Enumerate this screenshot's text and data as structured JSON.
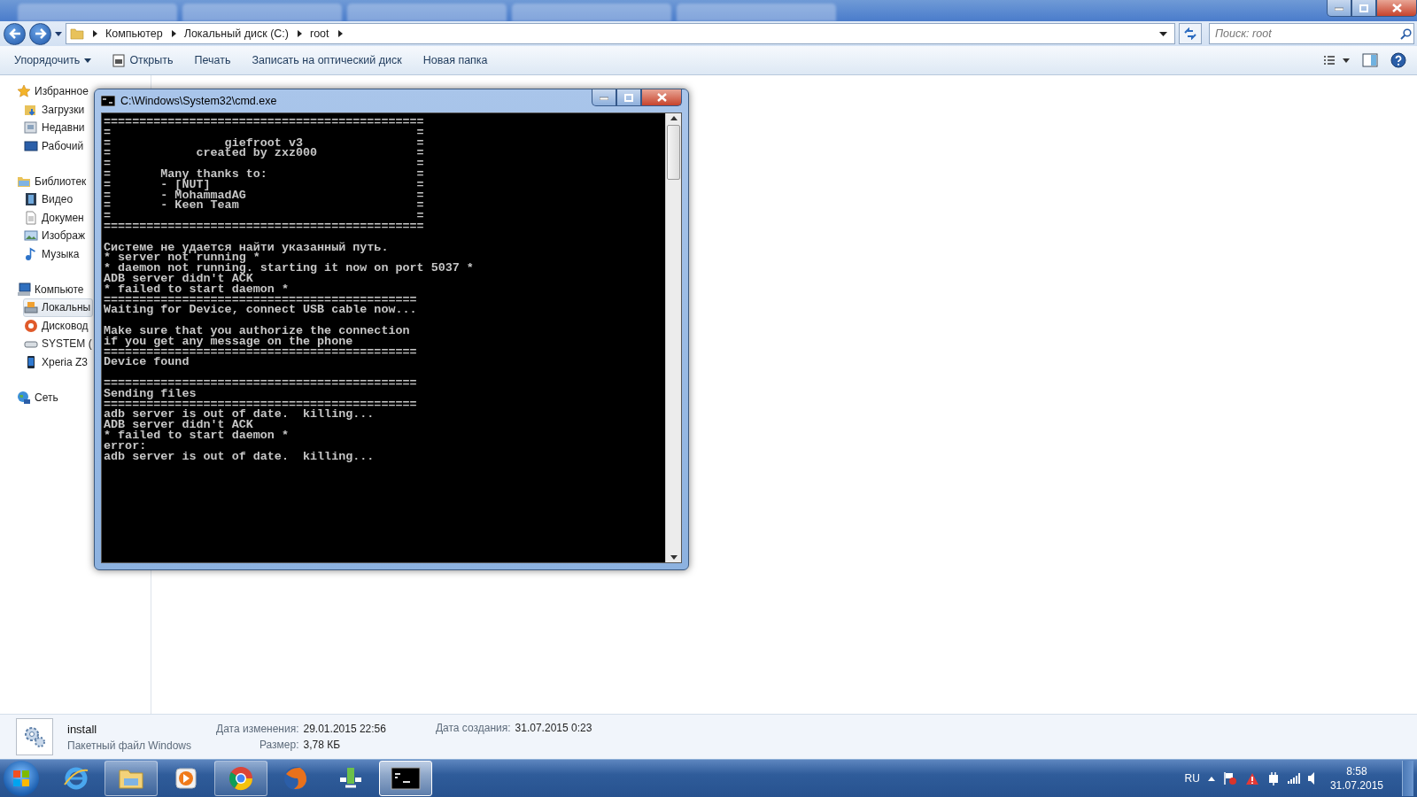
{
  "address_bar": {
    "breadcrumbs": [
      "Компьютер",
      "Локальный диск (C:)",
      "root"
    ],
    "search": {
      "placeholder": "Поиск: root"
    }
  },
  "toolbar": {
    "buttons": [
      {
        "label": "Упорядочить",
        "kind": "menu"
      },
      {
        "label": "Открыть",
        "kind": "icon"
      },
      {
        "label": "Печать",
        "kind": "plain"
      },
      {
        "label": "Записать на оптический диск",
        "kind": "plain"
      },
      {
        "label": "Новая папка",
        "kind": "plain"
      }
    ]
  },
  "sidebar": {
    "groups": [
      {
        "label": "Избранное",
        "items": [
          {
            "label": "Загрузки",
            "selected": false
          },
          {
            "label": "Недавни",
            "selected": false
          },
          {
            "label": "Рабочий",
            "selected": false
          }
        ]
      },
      {
        "label": "Библиотек",
        "items": [
          {
            "label": "Видео",
            "selected": false
          },
          {
            "label": "Докумен",
            "selected": false
          },
          {
            "label": "Изображ",
            "selected": false
          },
          {
            "label": "Музыка",
            "selected": false
          }
        ]
      },
      {
        "label": "Компьюте",
        "items": [
          {
            "label": "Локальны",
            "selected": true
          },
          {
            "label": "Дисковод",
            "selected": false
          },
          {
            "label": "SYSTEM (",
            "selected": false
          },
          {
            "label": "Xperia Z3",
            "selected": false
          }
        ]
      },
      {
        "label": "Сеть"
      }
    ]
  },
  "cmd_window": {
    "title": "C:\\Windows\\System32\\cmd.exe",
    "lines": [
      {
        "kind": "text",
        "text": "============================================="
      },
      {
        "kind": "text",
        "text": "=                                           ="
      },
      {
        "kind": "text",
        "text": "=                giefroot v3                ="
      },
      {
        "kind": "text",
        "text": "=            created by zxz000              ="
      },
      {
        "kind": "text",
        "text": "=                                           ="
      },
      {
        "kind": "text",
        "text": "=       Many thanks to:                     ="
      },
      {
        "kind": "text",
        "text": "=       - [NUT]                             ="
      },
      {
        "kind": "text",
        "text": "=       - MohammadAG                        ="
      },
      {
        "kind": "text",
        "text": "=       - Keen Team                         ="
      },
      {
        "kind": "text",
        "text": "=                                           ="
      },
      {
        "kind": "text",
        "text": "============================================="
      },
      {
        "kind": "blank"
      },
      {
        "kind": "text",
        "text": "Системе не удается найти указанный путь."
      },
      {
        "kind": "text",
        "text": "* server not running *"
      },
      {
        "kind": "text",
        "text": "* daemon not running. starting it now on port 5037 *"
      },
      {
        "kind": "text",
        "text": "ADB server didn't ACK"
      },
      {
        "kind": "text",
        "text": "* failed to start daemon *"
      },
      {
        "kind": "text",
        "text": "============================================"
      },
      {
        "kind": "text",
        "text": "Waiting for Device, connect USB cable now..."
      },
      {
        "kind": "blank"
      },
      {
        "kind": "text",
        "text": "Make sure that you authorize the connection"
      },
      {
        "kind": "text",
        "text": "if you get any message on the phone"
      },
      {
        "kind": "text",
        "text": "============================================"
      },
      {
        "kind": "text",
        "text": "Device found"
      },
      {
        "kind": "blank"
      },
      {
        "kind": "text",
        "text": "============================================"
      },
      {
        "kind": "text",
        "text": "Sending files"
      },
      {
        "kind": "text",
        "text": "============================================"
      },
      {
        "kind": "text",
        "text": "adb server is out of date.  killing..."
      },
      {
        "kind": "text",
        "text": "ADB server didn't ACK"
      },
      {
        "kind": "text",
        "text": "* failed to start daemon *"
      },
      {
        "kind": "text",
        "text": "error:"
      },
      {
        "kind": "text",
        "text": "adb server is out of date.  killing..."
      }
    ]
  },
  "details": {
    "name": "install",
    "type": "Пакетный файл Windows",
    "fields": [
      {
        "label": "Дата изменения:",
        "value": "29.01.2015 22:56"
      },
      {
        "label": "Размер:",
        "value": "3,78 КБ"
      },
      {
        "label": "Дата создания:",
        "value": "31.07.2015 0:23"
      }
    ]
  },
  "taskbar": {
    "apps": [
      {
        "running": false,
        "selected": false
      },
      {
        "running": true,
        "selected": false
      },
      {
        "running": false,
        "selected": false
      },
      {
        "running": true,
        "selected": false
      },
      {
        "running": false,
        "selected": false
      },
      {
        "running": false,
        "selected": false
      },
      {
        "running": true,
        "selected": true
      }
    ],
    "language": "RU",
    "time": "8:58",
    "date": "31.07.2015"
  }
}
